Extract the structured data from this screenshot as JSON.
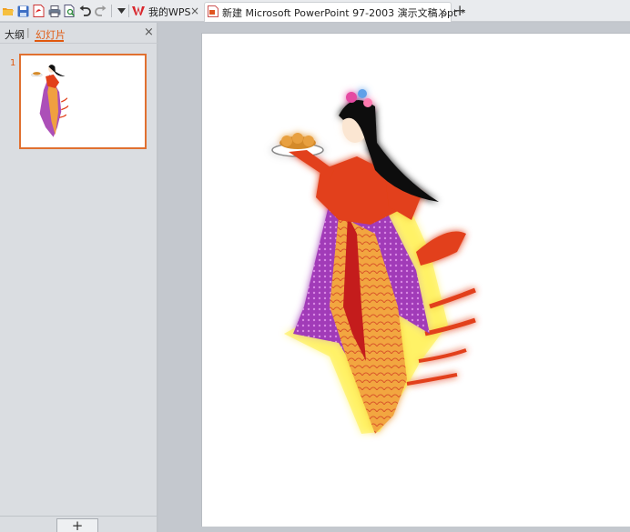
{
  "toolbar": {
    "icons": [
      "open-folder-icon",
      "save-icon",
      "export-pdf-icon",
      "print-icon",
      "print-preview-icon",
      "undo-icon",
      "redo-icon",
      "dropdown-icon"
    ]
  },
  "tabs": [
    {
      "label": "我的WPS",
      "close": "×",
      "active": false
    },
    {
      "label": "新建 Microsoft PowerPoint 97-2003 演示文稿.ppt *",
      "close": "×",
      "active": true
    }
  ],
  "new_tab": "+",
  "left_panel": {
    "outline_tab": "大纲",
    "divider": "|",
    "slides_tab": "幻灯片",
    "close": "×",
    "slides": [
      {
        "number": "1"
      }
    ],
    "add_button": "+"
  },
  "colors": {
    "accent": "#e0580e",
    "thumb_border": "#e07030",
    "toolbar_bg": "#e9ebee",
    "panel_bg": "#dadde1",
    "workspace_bg": "#c4c8ce"
  }
}
